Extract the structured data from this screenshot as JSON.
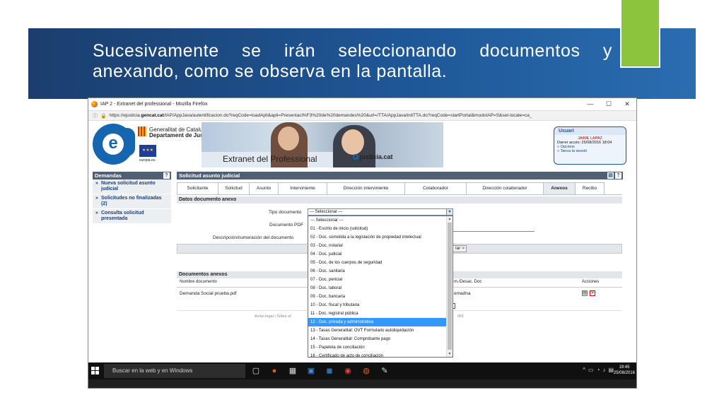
{
  "slide": {
    "title": "Sucesivamente se irán seleccionando documentos y anexando, como se observa en la pantalla."
  },
  "browser": {
    "window_title": "IAP 2 - Extranet del professional - Mozilla Firefox",
    "url_prefix": "https://ejusticia.",
    "url_host": "gencat.cat",
    "url_rest": "/IAP/AppJava/autentificacion.do?reqCode=loadApli&apli=Presentaci%F3%20de%20demandes%20&url=/TTA/AppJava/initTTA.do?reqCode=startPortal&modoIAP=S&set-locale=ca_",
    "minimize": "—",
    "maximize": "☐",
    "close": "✕"
  },
  "header": {
    "gencat_line1": "Generalitat de Catalunya",
    "gencat_line2": "Departament de Justícia",
    "eu_label": "europa.eu",
    "hero_text": "Extranet del Professional",
    "justicia_logo": "justicia.cat",
    "user_box": {
      "title": "Usuari",
      "name": "JAIME LAPAZ",
      "last_access": "Darrer accés: 25/08/2016 18:04",
      "options": "» Opcions",
      "close_session": "» Tanca la sessió"
    }
  },
  "left_panel": {
    "title": "Demandas",
    "help": "?",
    "items": [
      {
        "label": "Nueva solicitud asunto judicial"
      },
      {
        "label": "Solicitudes no finalizadas (2)"
      },
      {
        "label": "Consulta solicitud presentada"
      }
    ]
  },
  "main": {
    "title": "Solicitud asunto judicial",
    "tabs": [
      {
        "label": "Solicitante"
      },
      {
        "label": "Solicitud"
      },
      {
        "label": "Asunto"
      },
      {
        "label": "Interviniente"
      },
      {
        "label": "Dirección interviniente"
      },
      {
        "label": "Colaborador"
      },
      {
        "label": "Dirección colaborador"
      },
      {
        "label": "Anexos"
      },
      {
        "label": "Recibo"
      }
    ],
    "section_title": "Datos documento anexo",
    "labels": {
      "tipo": "Tipo documento",
      "documento": "Documento PDF",
      "descripcion": "Descripción/numeración del documento"
    },
    "tipo_value": "--- Seleccionar ---",
    "siguiente_label": "lar >",
    "anexos_title": "Documentos anexos",
    "table_headers": {
      "nombre": "Nombre documento",
      "desc": "m./Desac. Doc",
      "acciones": "Acciones"
    },
    "row": {
      "nombre": "Demanda Social prueba.pdf",
      "desc": "emadna"
    },
    "footer_text": "Avíso legal | Sobre el",
    "footer_text2": "001"
  },
  "dropdown": {
    "options": [
      "--- Seleccionar ---",
      "01 - Escrito de inicio (solicitud)",
      "02 - Doc. sometida a la legislación de propiedad intelectual",
      "03 - Doc. notarial",
      "04 - Doc. judicial",
      "05 - Doc. de los cuerpos de seguridad",
      "06 - Doc. sanitaria",
      "07 - Doc. pericial",
      "08 - Doc. laboral",
      "09 - Doc. bancaria",
      "10 - Doc. fiscal y tributaria",
      "11 - Doc. registral pública",
      "12 - Doc. privada y administrativa",
      "13 - Tasas Generalitat: OVT Formulario autoliquidación",
      "14 - Tasas Generalitat: Comprobante pago",
      "15 - Papeleta de conciliación",
      "16 - Certificado de acto de conciliación"
    ],
    "selected_index": 12
  },
  "taskbar": {
    "search": "Buscar en la web y en Windows",
    "time": "19:45",
    "date": "25/08/2016"
  }
}
